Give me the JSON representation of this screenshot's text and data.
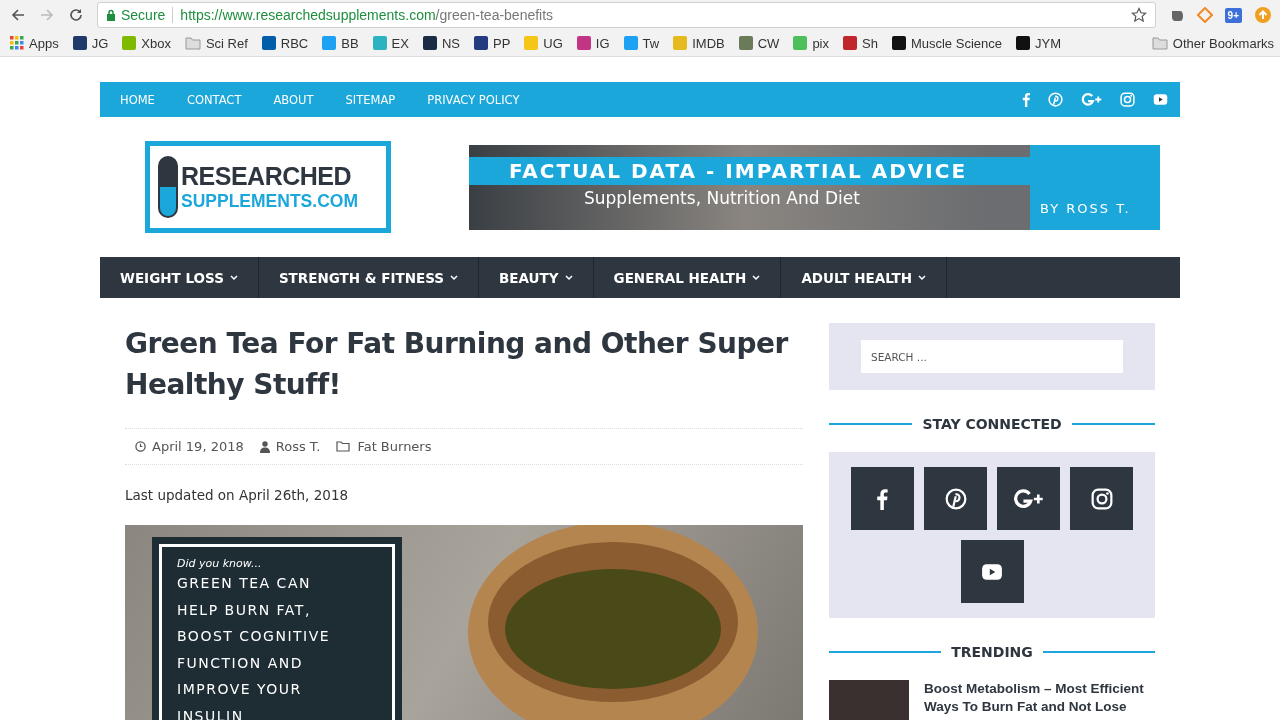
{
  "browser": {
    "secure_label": "Secure",
    "url_host": "https://www.researchedsupplements.com",
    "url_path": "/green-tea-benefits",
    "extension_badge": "9+",
    "bookmarks": [
      {
        "label": "Apps",
        "kind": "apps"
      },
      {
        "label": "JG",
        "kind": "site",
        "color": "#1f3a6b"
      },
      {
        "label": "Xbox",
        "kind": "site",
        "color": "#7fba00"
      },
      {
        "label": "Sci Ref",
        "kind": "folder"
      },
      {
        "label": "RBC",
        "kind": "site",
        "color": "#005daa"
      },
      {
        "label": "BB",
        "kind": "site",
        "color": "#1da1f2"
      },
      {
        "label": "EX",
        "kind": "site",
        "color": "#2bb3c0"
      },
      {
        "label": "NS",
        "kind": "site",
        "color": "#1a2b44"
      },
      {
        "label": "PP",
        "kind": "site",
        "color": "#253b80"
      },
      {
        "label": "UG",
        "kind": "site",
        "color": "#f5c518"
      },
      {
        "label": "IG",
        "kind": "site",
        "color": "#c13584"
      },
      {
        "label": "Tw",
        "kind": "site",
        "color": "#1da1f2"
      },
      {
        "label": "IMDB",
        "kind": "site",
        "color": "#e6b91e"
      },
      {
        "label": "CW",
        "kind": "site",
        "color": "#6b7b5a"
      },
      {
        "label": "pix",
        "kind": "site",
        "color": "#4fbe5c"
      },
      {
        "label": "Sh",
        "kind": "site",
        "color": "#c0262c"
      },
      {
        "label": "Muscle Science",
        "kind": "site",
        "color": "#111111"
      },
      {
        "label": "JYM",
        "kind": "site",
        "color": "#111111"
      }
    ],
    "other_bookmarks": "Other Bookmarks"
  },
  "top_nav": [
    "HOME",
    "CONTACT",
    "ABOUT",
    "SITEMAP",
    "PRIVACY POLICY"
  ],
  "logo": {
    "line_1": "RESEARCHED",
    "line_2": "SUPPLEMENTS.COM"
  },
  "banner": {
    "headline": "FACTUAL DATA - IMPARTIAL ADVICE",
    "subline": "Supplements, Nutrition And Diet",
    "byline": "BY ROSS T."
  },
  "main_nav": [
    "WEIGHT LOSS",
    "STRENGTH & FITNESS",
    "BEAUTY",
    "GENERAL HEALTH",
    "ADULT HEALTH"
  ],
  "article": {
    "title": "Green Tea For Fat Burning and Other Super Healthy Stuff!",
    "date": "April 19, 2018",
    "author": "Ross T.",
    "category": "Fat Burners",
    "updated": "Last updated on April 26th, 2018",
    "image": {
      "intro": "Did you know...",
      "lines": [
        "GREEN TEA CAN",
        "HELP BURN FAT,",
        "BOOST COGNITIVE",
        "FUNCTION AND",
        "IMPROVE YOUR",
        "INSULIN"
      ]
    }
  },
  "sidebar": {
    "search_placeholder": "SEARCH ...",
    "stay_connected": "STAY CONNECTED",
    "trending": "TRENDING",
    "trending_items": [
      {
        "title": "Boost Metabolism – Most Efficient Ways To Burn Fat and Not Lose"
      }
    ]
  }
}
